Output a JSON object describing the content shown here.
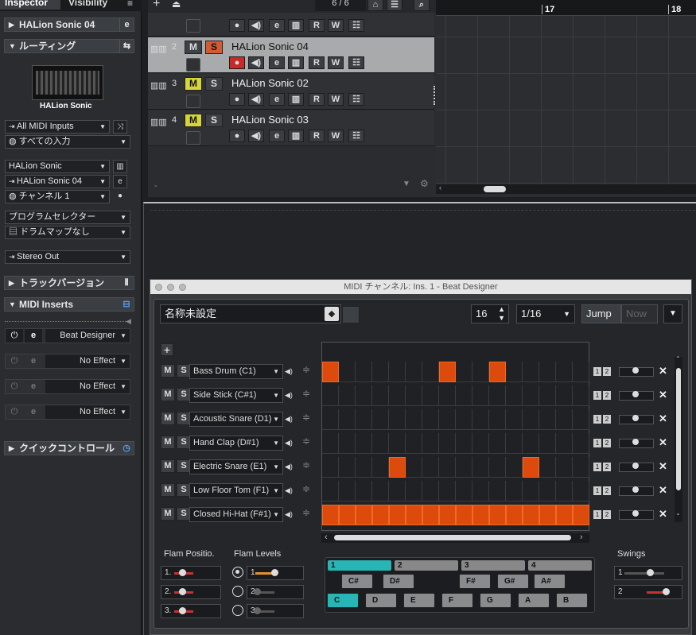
{
  "inspector": {
    "tab_inspector": "Inspector",
    "tab_visibility": "Visibility",
    "track_name": "HALion Sonic 04",
    "routing_title": "ルーティング",
    "instrument_caption": "HALion Sonic",
    "midi_input": "All MIDI Inputs",
    "input_all": "すべての入力",
    "instrument": "HALion Sonic",
    "output_instrument": "HALion Sonic 04",
    "channel": "チャンネル 1",
    "program_selector": "プログラムセレクター",
    "drum_map": "ドラムマップなし",
    "audio_out": "Stereo Out",
    "track_versions": "トラックバージョン",
    "midi_inserts": "MIDI Inserts",
    "inserts": [
      "Beat Designer",
      "No Effect",
      "No Effect",
      "No Effect"
    ],
    "quick_controls": "クイックコントロール"
  },
  "toolbar": {
    "counter": "6 / 6"
  },
  "tracks": [
    {
      "num": "2",
      "name": "HALion Sonic 04",
      "m": "M",
      "s": "S"
    },
    {
      "num": "3",
      "name": "HALion Sonic 02",
      "m": "M",
      "s": "S"
    },
    {
      "num": "4",
      "name": "HALion Sonic 03",
      "m": "M",
      "s": "S"
    }
  ],
  "ruler": {
    "bar17": "17",
    "bar18": "18"
  },
  "beat_designer": {
    "window_title": "MIDI チャンネル: Ins. 1 - Beat Designer",
    "preset": "名称未設定",
    "steps": "16",
    "resolution": "1/16",
    "jump": "Jump",
    "now": "Now",
    "instruments": [
      "Bass Drum (C1)",
      "Side Stick (C#1)",
      "Acoustic Snare (D1)",
      "Hand Clap (D#1)",
      "Electric Snare (E1)",
      "Low Floor Tom (F1)",
      "Closed Hi-Hat (F#1)"
    ],
    "pattern": [
      [
        1,
        0,
        0,
        0,
        0,
        0,
        0,
        1,
        0,
        0,
        1,
        0,
        0,
        0,
        0,
        0
      ],
      [
        0,
        0,
        0,
        0,
        0,
        0,
        0,
        0,
        0,
        0,
        0,
        0,
        0,
        0,
        0,
        0
      ],
      [
        0,
        0,
        0,
        0,
        0,
        0,
        0,
        0,
        0,
        0,
        0,
        0,
        0,
        0,
        0,
        0
      ],
      [
        0,
        0,
        0,
        0,
        0,
        0,
        0,
        0,
        0,
        0,
        0,
        0,
        0,
        0,
        0,
        0
      ],
      [
        0,
        0,
        0,
        0,
        1,
        0,
        0,
        0,
        0,
        0,
        0,
        0,
        1,
        0,
        0,
        0
      ],
      [
        0,
        0,
        0,
        0,
        0,
        0,
        0,
        0,
        0,
        0,
        0,
        0,
        0,
        0,
        0,
        0
      ],
      [
        1,
        1,
        1,
        1,
        1,
        1,
        1,
        1,
        1,
        1,
        1,
        1,
        1,
        1,
        1,
        1
      ]
    ],
    "flam_positions_label": "Flam Positio.",
    "flam_levels_label": "Flam Levels",
    "swings_label": "Swings",
    "flam_pos": [
      "1.",
      "2.",
      "3."
    ],
    "flam_lvl": [
      "1",
      "2",
      "3"
    ],
    "swings": [
      "1",
      "2"
    ],
    "pages": [
      "1",
      "2",
      "3",
      "4"
    ],
    "sharps": [
      "C#",
      "D#",
      "F#",
      "G#",
      "A#"
    ],
    "naturals": [
      "C",
      "D",
      "E",
      "F",
      "G",
      "A",
      "B"
    ]
  }
}
